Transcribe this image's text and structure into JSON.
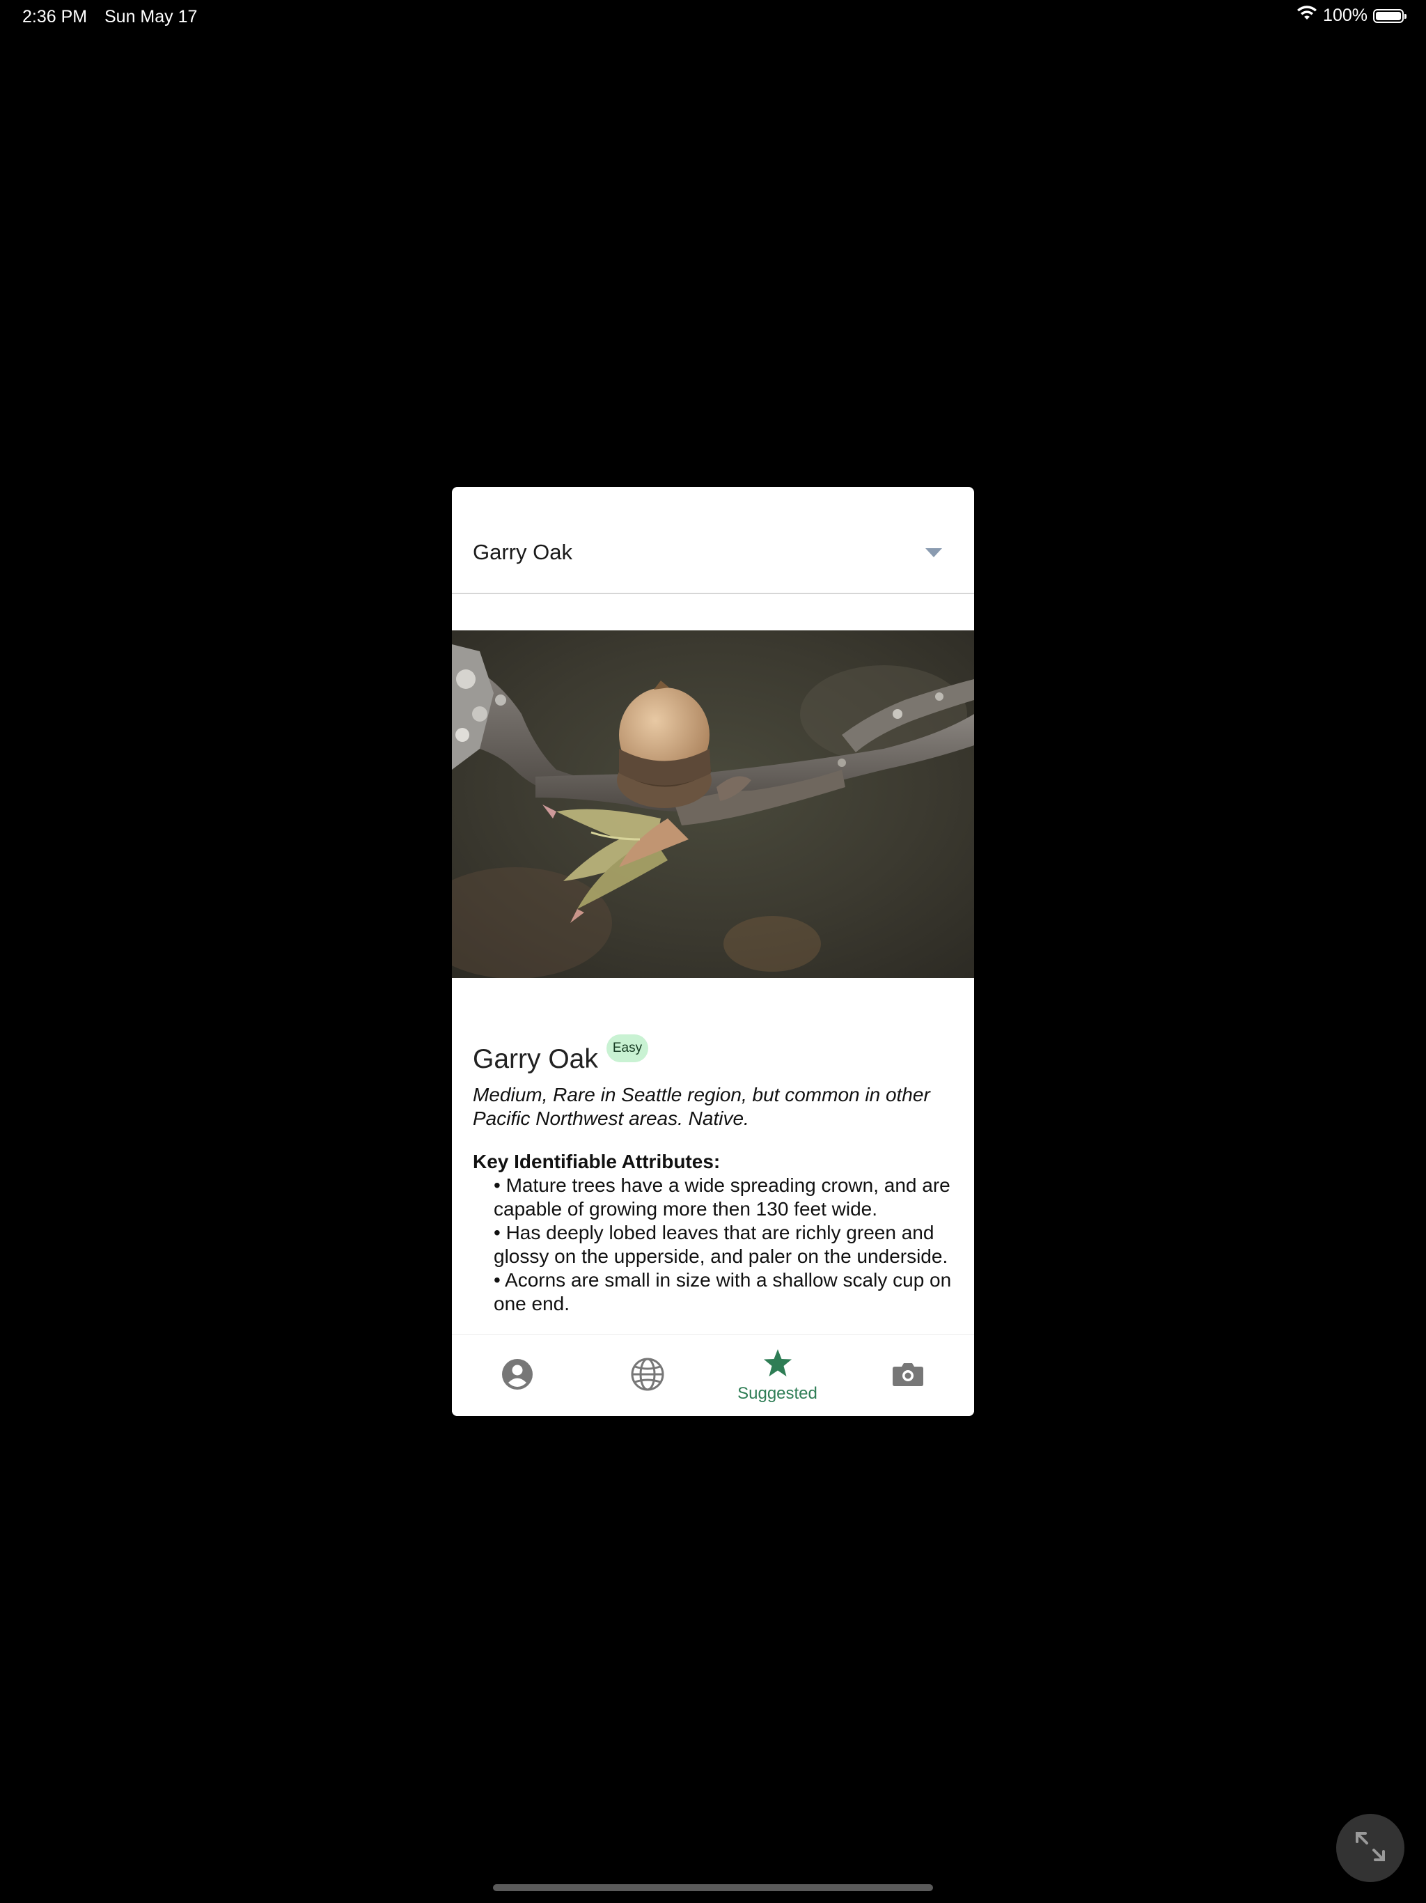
{
  "status_bar": {
    "time": "2:36 PM",
    "date": "Sun May 17",
    "battery_percent": "100%",
    "battery_level": 1.0
  },
  "selector": {
    "value": "Garry Oak"
  },
  "tree": {
    "name": "Garry Oak",
    "difficulty": "Easy",
    "summary": "Medium, Rare in Seattle region, but common in other Pacific Northwest areas. Native.",
    "attributes_heading": "Key Identifiable Attributes:",
    "attributes": [
      "• Mature trees have a wide spreading crown, and are capable of growing more then 130 feet wide.",
      "• Has deeply lobed leaves that are richly green and glossy on the upperside, and paler on the underside.",
      "• Acorns are small in size with a shallow scaly cup on one end."
    ]
  },
  "tabs": [
    {
      "icon": "account-icon",
      "label": ""
    },
    {
      "icon": "globe-icon",
      "label": ""
    },
    {
      "icon": "star-icon",
      "label": "Suggested",
      "active": true
    },
    {
      "icon": "camera-icon",
      "label": ""
    }
  ],
  "colors": {
    "accent": "#2e7d55",
    "badge_bg": "#c9f2d3",
    "icon_gray": "#777777"
  }
}
